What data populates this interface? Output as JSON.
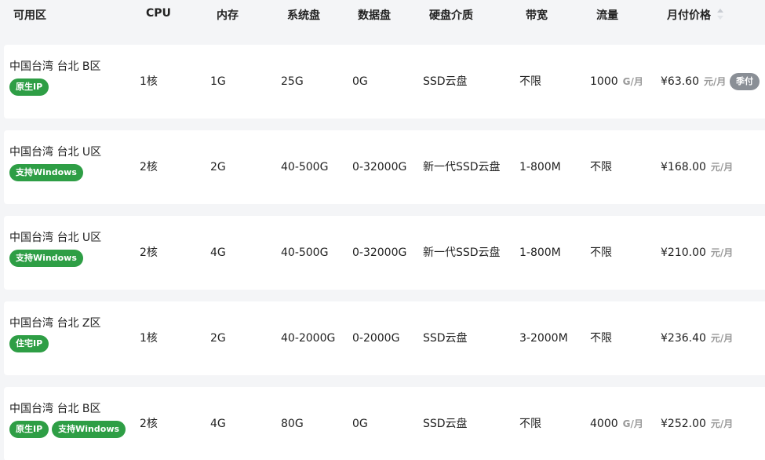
{
  "header": {
    "zone": "可用区",
    "cpu": "CPU",
    "memory": "内存",
    "system_disk": "系统盘",
    "data_disk": "数据盘",
    "disk_medium": "硬盘介质",
    "bandwidth": "带宽",
    "traffic": "流量",
    "monthly_price": "月付价格"
  },
  "rows": [
    {
      "zone": "中国台湾 台北 B区",
      "tags": [
        "原生IP"
      ],
      "cpu": "1核",
      "memory": "1G",
      "system_disk": "25G",
      "data_disk": "0G",
      "disk_medium": "SSD云盘",
      "bandwidth": "不限",
      "traffic": "1000",
      "traffic_unit": "G/月",
      "price": "¥63.60",
      "price_unit": "元/月",
      "badge": "季付"
    },
    {
      "zone": "中国台湾 台北 U区",
      "tags": [
        "支持Windows"
      ],
      "cpu": "2核",
      "memory": "2G",
      "system_disk": "40-500G",
      "data_disk": "0-32000G",
      "disk_medium": "新一代SSD云盘",
      "bandwidth": "1-800M",
      "traffic": "不限",
      "traffic_unit": "",
      "price": "¥168.00",
      "price_unit": "元/月",
      "badge": ""
    },
    {
      "zone": "中国台湾 台北 U区",
      "tags": [
        "支持Windows"
      ],
      "cpu": "2核",
      "memory": "4G",
      "system_disk": "40-500G",
      "data_disk": "0-32000G",
      "disk_medium": "新一代SSD云盘",
      "bandwidth": "1-800M",
      "traffic": "不限",
      "traffic_unit": "",
      "price": "¥210.00",
      "price_unit": "元/月",
      "badge": ""
    },
    {
      "zone": "中国台湾 台北 Z区",
      "tags": [
        "住宅IP"
      ],
      "cpu": "1核",
      "memory": "2G",
      "system_disk": "40-2000G",
      "data_disk": "0-2000G",
      "disk_medium": "SSD云盘",
      "bandwidth": "3-2000M",
      "traffic": "不限",
      "traffic_unit": "",
      "price": "¥236.40",
      "price_unit": "元/月",
      "badge": ""
    },
    {
      "zone": "中国台湾 台北 B区",
      "tags": [
        "原生IP",
        "支持Windows"
      ],
      "cpu": "2核",
      "memory": "4G",
      "system_disk": "80G",
      "data_disk": "0G",
      "disk_medium": "SSD云盘",
      "bandwidth": "不限",
      "traffic": "4000",
      "traffic_unit": "G/月",
      "price": "¥252.00",
      "price_unit": "元/月",
      "badge": ""
    }
  ]
}
